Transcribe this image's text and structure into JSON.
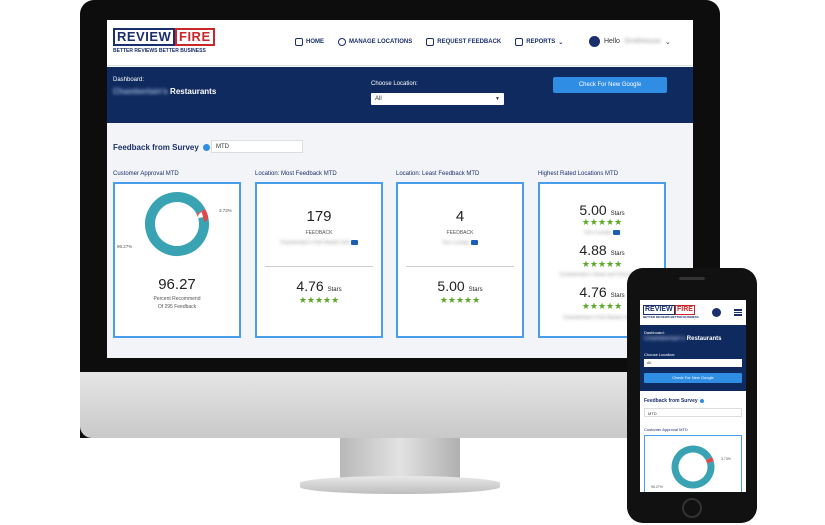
{
  "brand": {
    "word1": "REVIEW",
    "word2": "FIRE",
    "tagline": "BETTER REVIEWS BETTER BUSINESS"
  },
  "nav": {
    "items": [
      {
        "label": "HOME",
        "icon": "home-icon"
      },
      {
        "label": "MANAGE LOCATIONS",
        "icon": "users-icon"
      },
      {
        "label": "REQUEST FEEDBACK",
        "icon": "star-icon"
      },
      {
        "label": "REPORTS",
        "icon": "report-icon"
      }
    ],
    "reports_caret": "⌄",
    "greeting": "Hello",
    "user_name": "Smithhouse"
  },
  "banner": {
    "dashboard_label": "Dashboard:",
    "restaurant_blurred": "Chamberlain's",
    "restaurant_suffix": "Restaurants",
    "choose_location_label": "Choose Location:",
    "location_value": "All",
    "check_button": "Check For New Google"
  },
  "feedback": {
    "title": "Feedback from Survey",
    "period": "MTD"
  },
  "cards": {
    "approval": {
      "title": "Customer Approval MTD",
      "value": "96.27",
      "caption1": "Percent Recommend",
      "caption2": "Of 295 Feedback",
      "slice_large_label": "96.27%",
      "slice_small_label": "3.73%"
    },
    "most": {
      "title": "Location: Most Feedback MTD",
      "count": "179",
      "count_label": "FEEDBACK",
      "location_blurred": "Chamberlain's Fish Market Grill",
      "rating": "4.76",
      "rating_unit": "Stars",
      "stars": "★★★★★"
    },
    "least": {
      "title": "Location: Least Feedback MTD",
      "count": "4",
      "count_label": "FEEDBACK",
      "location_blurred": "Ozo Lounge",
      "rating": "5.00",
      "rating_unit": "Stars",
      "stars": "★★★★★"
    },
    "highest": {
      "title": "Highest Rated Locations MTD",
      "entries": [
        {
          "rating": "5.00",
          "unit": "Stars",
          "stars": "★★★★★",
          "location_blurred": "Ozo Lounge"
        },
        {
          "rating": "4.88",
          "unit": "Stars",
          "stars": "★★★★★",
          "location_blurred": "Chamberlain's Steak and Chop House"
        },
        {
          "rating": "4.76",
          "unit": "Stars",
          "stars": "★★★★★",
          "location_blurred": "Chamberlain's Fish Market Grill"
        }
      ]
    }
  },
  "chart_data": {
    "type": "pie",
    "categories": [
      "",
      ""
    ],
    "values": [
      96.27,
      3.73
    ],
    "labels": [
      "96.27%",
      "3.73%"
    ],
    "colors": [
      "#3aa3b3",
      "#e0474c"
    ],
    "donut": true
  },
  "mobile": {
    "dashboard_label": "Dashboard:",
    "restaurant_blurred": "Chamberlain's",
    "restaurant_suffix": "Restaurants",
    "choose_location_label": "Choose Location:",
    "location_value": "All",
    "check_button": "Check For New Google",
    "feedback_title": "Feedback from Survey",
    "period": "MTD",
    "approval_title": "Customer Approval MTD",
    "slice_small_label": "3.73%",
    "slice_large_label": "96.27%"
  }
}
